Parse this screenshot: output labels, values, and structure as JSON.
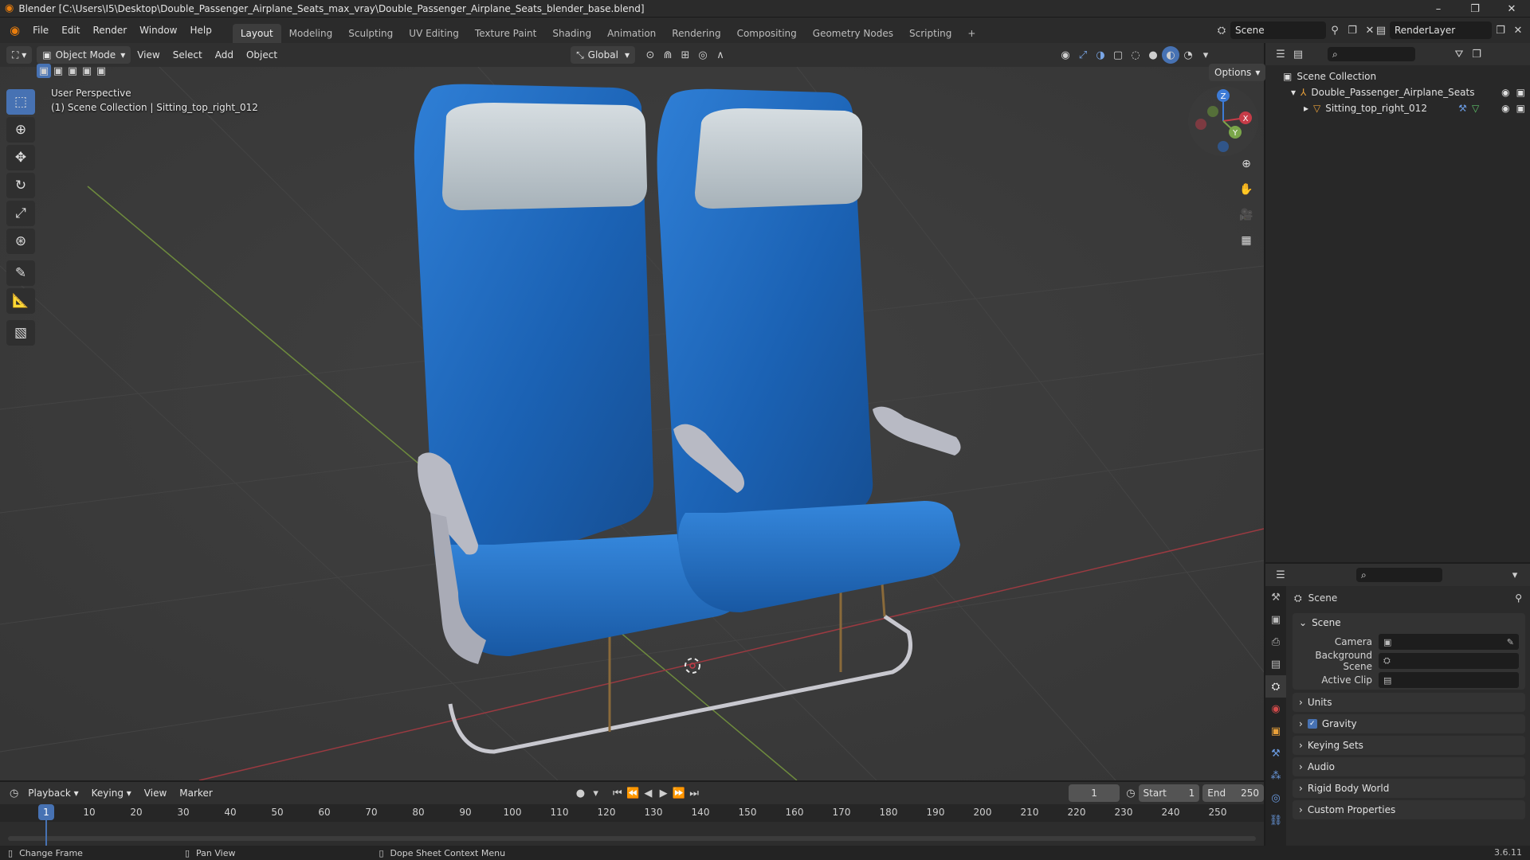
{
  "window": {
    "title": "Blender [C:\\Users\\I5\\Desktop\\Double_Passenger_Airplane_Seats_max_vray\\Double_Passenger_Airplane_Seats_blender_base.blend]",
    "controls": [
      "–",
      "❐",
      "✕"
    ]
  },
  "menu": {
    "items": [
      "File",
      "Edit",
      "Render",
      "Window",
      "Help"
    ]
  },
  "workspaces": {
    "tabs": [
      "Layout",
      "Modeling",
      "Sculpting",
      "UV Editing",
      "Texture Paint",
      "Shading",
      "Animation",
      "Rendering",
      "Compositing",
      "Geometry Nodes",
      "Scripting"
    ],
    "active": "Layout",
    "add": "+"
  },
  "scene_selector": {
    "value": "Scene"
  },
  "view_layer": {
    "value": "RenderLayer"
  },
  "viewport_header": {
    "mode": "Object Mode",
    "menus": [
      "View",
      "Select",
      "Add",
      "Object"
    ],
    "transform_orientation": "Global",
    "options": "Options"
  },
  "viewport": {
    "info_line1": "User Perspective",
    "info_line2": "(1) Scene Collection | Sitting_top_right_012",
    "gizmo": {
      "x": "X",
      "y": "Y",
      "z": "Z"
    },
    "colors": {
      "x_axis": "#c63c48",
      "y_axis": "#7aa64a",
      "z_axis": "#3d7bd6",
      "seat_blue": "#1e66b8",
      "headrest": "#b9c3c9",
      "frame": "#a9a9b3"
    }
  },
  "outliner": {
    "root": "Scene Collection",
    "items": [
      {
        "label": "Double_Passenger_Airplane_Seats",
        "depth": 1
      },
      {
        "label": "Sitting_top_right_012",
        "depth": 2
      }
    ]
  },
  "properties": {
    "context": "Scene",
    "panel_title": "Scene",
    "fields": [
      {
        "label": "Camera",
        "value": ""
      },
      {
        "label": "Background Scene",
        "value": ""
      },
      {
        "label": "Active Clip",
        "value": ""
      }
    ],
    "subpanels": [
      "Units",
      "Gravity",
      "Keying Sets",
      "Audio",
      "Rigid Body World",
      "Custom Properties"
    ]
  },
  "timeline": {
    "menus": [
      "Playback",
      "Keying",
      "View",
      "Marker"
    ],
    "current_frame": "1",
    "start_label": "Start",
    "start": "1",
    "end_label": "End",
    "end": "250",
    "ticks": [
      "10",
      "20",
      "30",
      "40",
      "50",
      "60",
      "70",
      "80",
      "90",
      "100",
      "110",
      "120",
      "130",
      "140",
      "150",
      "160",
      "170",
      "180",
      "190",
      "200",
      "210",
      "220",
      "230",
      "240",
      "250"
    ],
    "playhead": "1"
  },
  "status_bar": {
    "items": [
      "Change Frame",
      "Pan View",
      "Dope Sheet Context Menu"
    ],
    "version": "3.6.11"
  }
}
